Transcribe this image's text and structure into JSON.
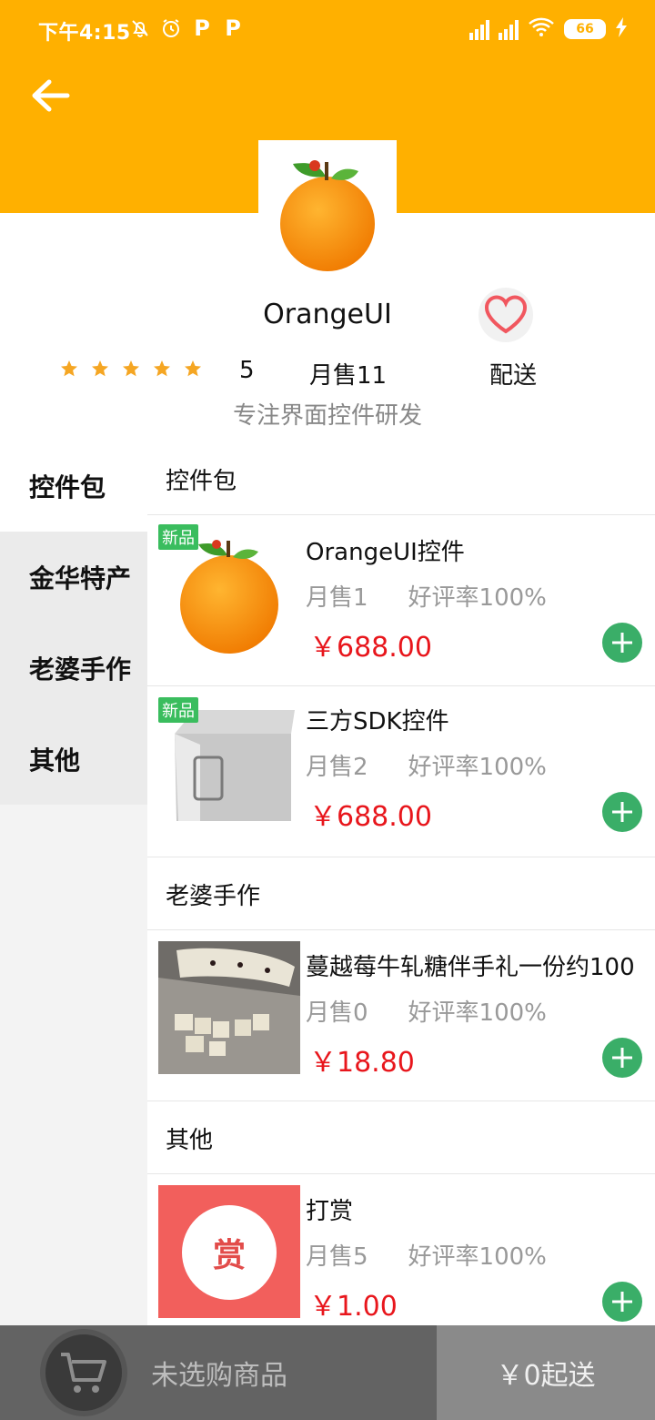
{
  "status_bar": {
    "time": "下午4:15",
    "battery": "66",
    "p_icon_1": "P",
    "p_icon_2": "P",
    "icons": [
      "bell-muted-icon",
      "alarm-icon",
      "p-app-icon",
      "p-app-icon",
      "hd-signal-icon",
      "signal-icon",
      "wifi-icon",
      "battery-icon",
      "charging-icon"
    ]
  },
  "colors": {
    "header": "#FFB000",
    "price": "#E8161C",
    "add_button": "#3AAE68",
    "new_tag": "#3ABD5E",
    "star": "#F5A623"
  },
  "store": {
    "name": "OrangeUI",
    "rating": "5",
    "monthly_sales": "月售11",
    "delivery": "配送",
    "slogan": "专注界面控件研发",
    "stars": 5
  },
  "sidebar": {
    "items": [
      {
        "label": "控件包",
        "active": true
      },
      {
        "label": "金华特产",
        "active": false
      },
      {
        "label": "老婆手作",
        "active": false
      },
      {
        "label": "其他",
        "active": false
      }
    ]
  },
  "sections": [
    {
      "title": "控件包",
      "products": [
        {
          "name": "OrangeUI控件",
          "sales": "月售1",
          "rating": "好评率100%",
          "price": "￥688.00",
          "tag": "新品",
          "image": "orange-logo"
        },
        {
          "name": "三方SDK控件",
          "sales": "月售2",
          "rating": "好评率100%",
          "price": "￥688.00",
          "tag": "新品",
          "image": "sdk-box"
        }
      ]
    },
    {
      "title": "老婆手作",
      "products": [
        {
          "name": "蔓越莓牛轧糖伴手礼一份约100",
          "sales": "月售0",
          "rating": "好评率100%",
          "price": "￥18.80",
          "tag": "",
          "image": "nougat-photo"
        }
      ]
    },
    {
      "title": "其他",
      "products": [
        {
          "name": "打赏",
          "sales": "月售5",
          "rating": "好评率100%",
          "price": "￥1.00",
          "tag": "",
          "image": "reward-badge",
          "badge_text": "赏"
        }
      ]
    }
  ],
  "cart": {
    "empty_text": "未选购商品",
    "checkout_text": "￥0起送"
  }
}
